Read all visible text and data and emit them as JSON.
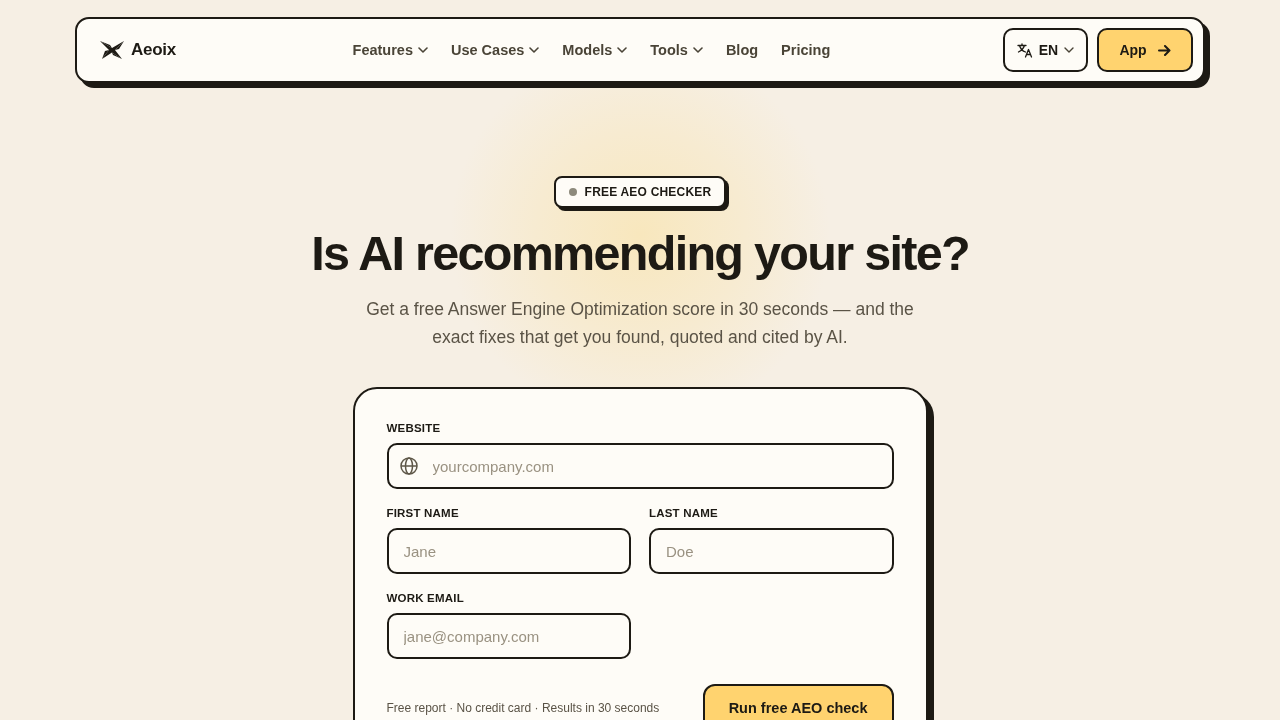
{
  "nav": {
    "logo": "Aeoix",
    "items": [
      {
        "label": "Features",
        "dropdown": true
      },
      {
        "label": "Use Cases",
        "dropdown": true
      },
      {
        "label": "Models",
        "dropdown": true
      },
      {
        "label": "Tools",
        "dropdown": true
      },
      {
        "label": "Blog",
        "dropdown": false
      },
      {
        "label": "Pricing",
        "dropdown": false
      }
    ],
    "language": "EN",
    "app_button": "App"
  },
  "hero": {
    "badge": "FREE AEO CHECKER",
    "title": "Is AI recommending your site?",
    "subtitle": "Get a free Answer Engine Optimization score in 30 seconds — and the exact fixes that get you found, quoted and cited by AI."
  },
  "form": {
    "fields": [
      {
        "kind": "website",
        "label": "WEBSITE",
        "placeholder": "yourcompany.com"
      },
      {
        "kind": "text",
        "label": "FIRST NAME",
        "placeholder": "Jane"
      },
      {
        "kind": "text",
        "label": "LAST NAME",
        "placeholder": "Doe"
      },
      {
        "kind": "email",
        "label": "WORK EMAIL",
        "placeholder": "jane@company.com"
      }
    ],
    "note": "Free report · No credit card · Results in 30 seconds",
    "submit": "Run free AEO check"
  }
}
